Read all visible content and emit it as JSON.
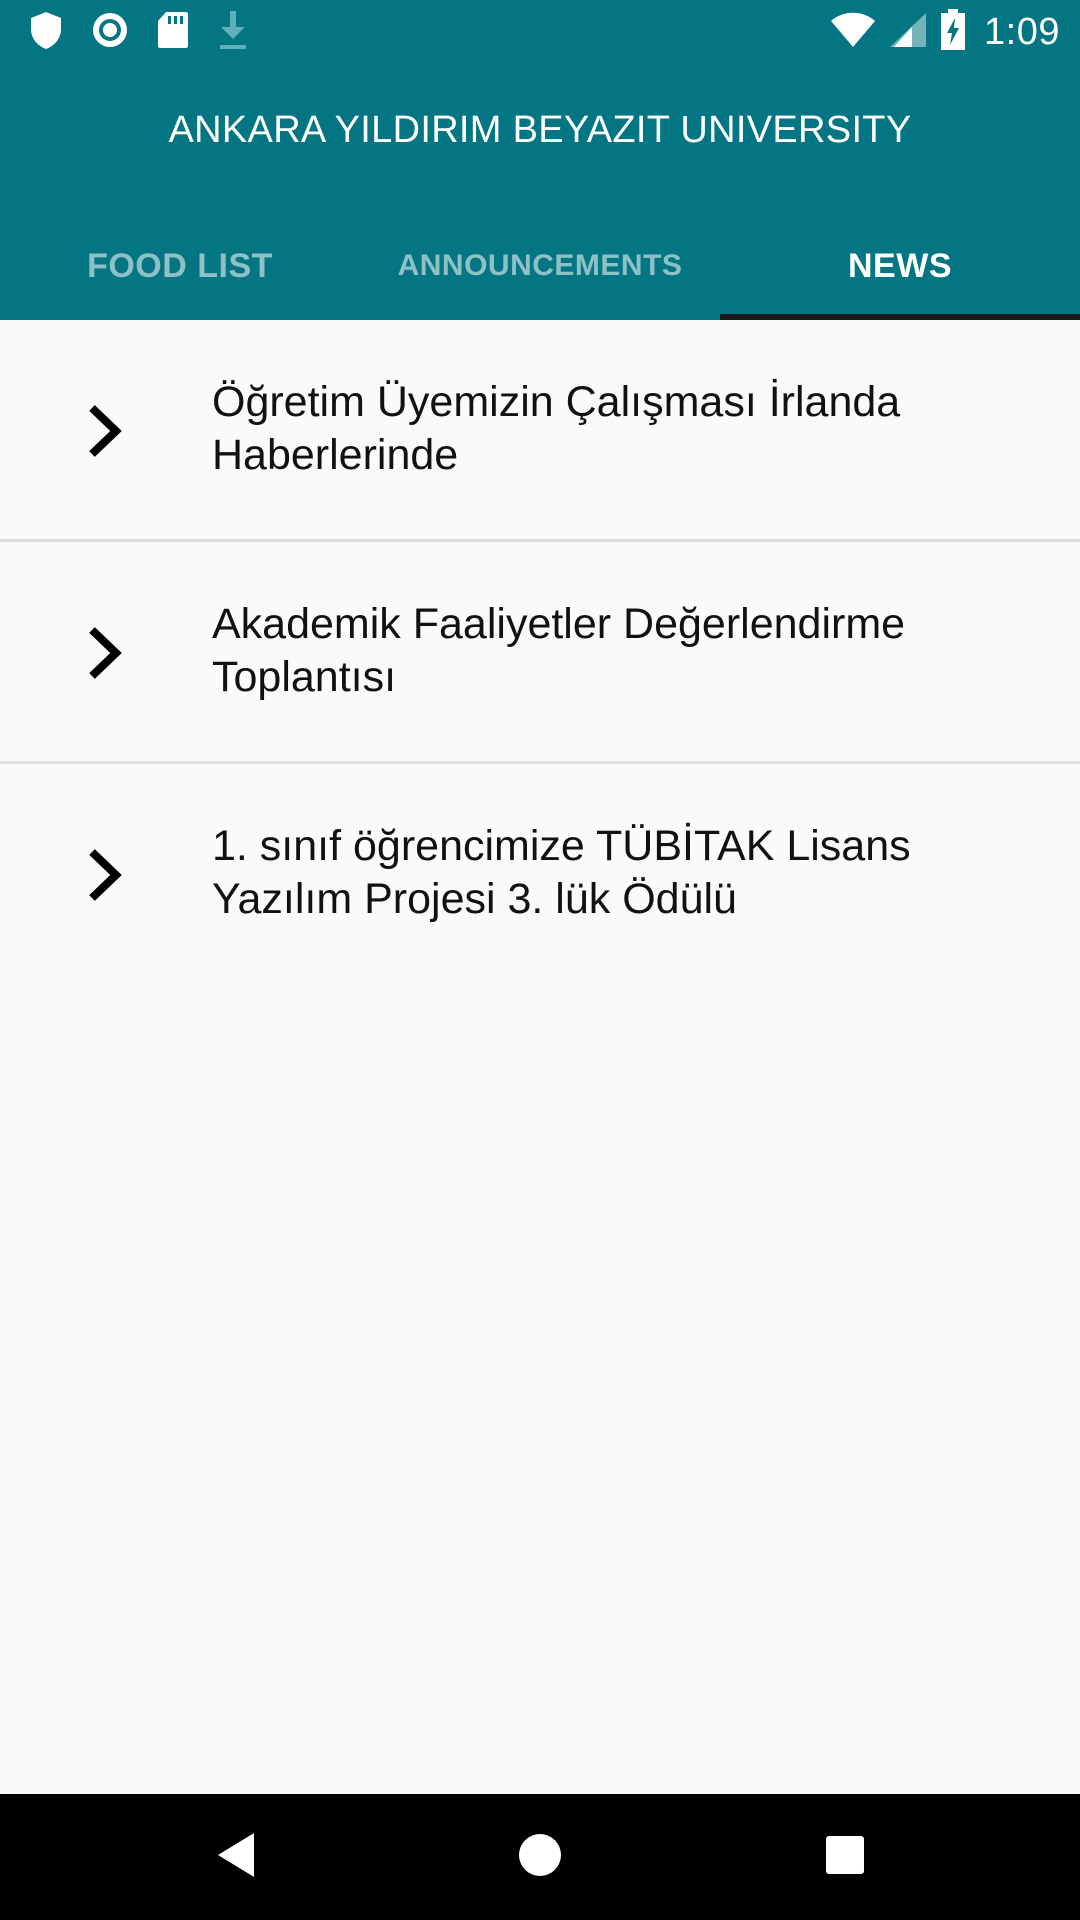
{
  "status_bar": {
    "time": "1:09",
    "left_icons": [
      "shield-icon",
      "radio-icon",
      "sd-card-icon",
      "download-icon"
    ],
    "right_icons": [
      "wifi-icon",
      "cell-signal-icon",
      "battery-charging-icon"
    ]
  },
  "app": {
    "title": "ANKARA YILDIRIM BEYAZIT UNIVERSITY",
    "bar_color": "#047582"
  },
  "tabs": [
    {
      "label": "FOOD LIST",
      "active": false
    },
    {
      "label": "ANNOUNCEMENTS",
      "active": false
    },
    {
      "label": "NEWS",
      "active": true
    }
  ],
  "news": [
    {
      "icon": "chevron-right-icon",
      "title": "Öğretim Üyemizin Çalışması İrlanda Haberlerinde"
    },
    {
      "icon": "chevron-right-icon",
      "title": "Akademik Faaliyetler Değerlendirme Toplantısı"
    },
    {
      "icon": "chevron-right-icon",
      "title": "1. sınıf öğrencimize TÜBİTAK Lisans Yazılım Projesi 3. lük Ödülü"
    }
  ],
  "nav_bar": {
    "buttons": [
      "back-icon",
      "home-icon",
      "recents-icon"
    ]
  }
}
